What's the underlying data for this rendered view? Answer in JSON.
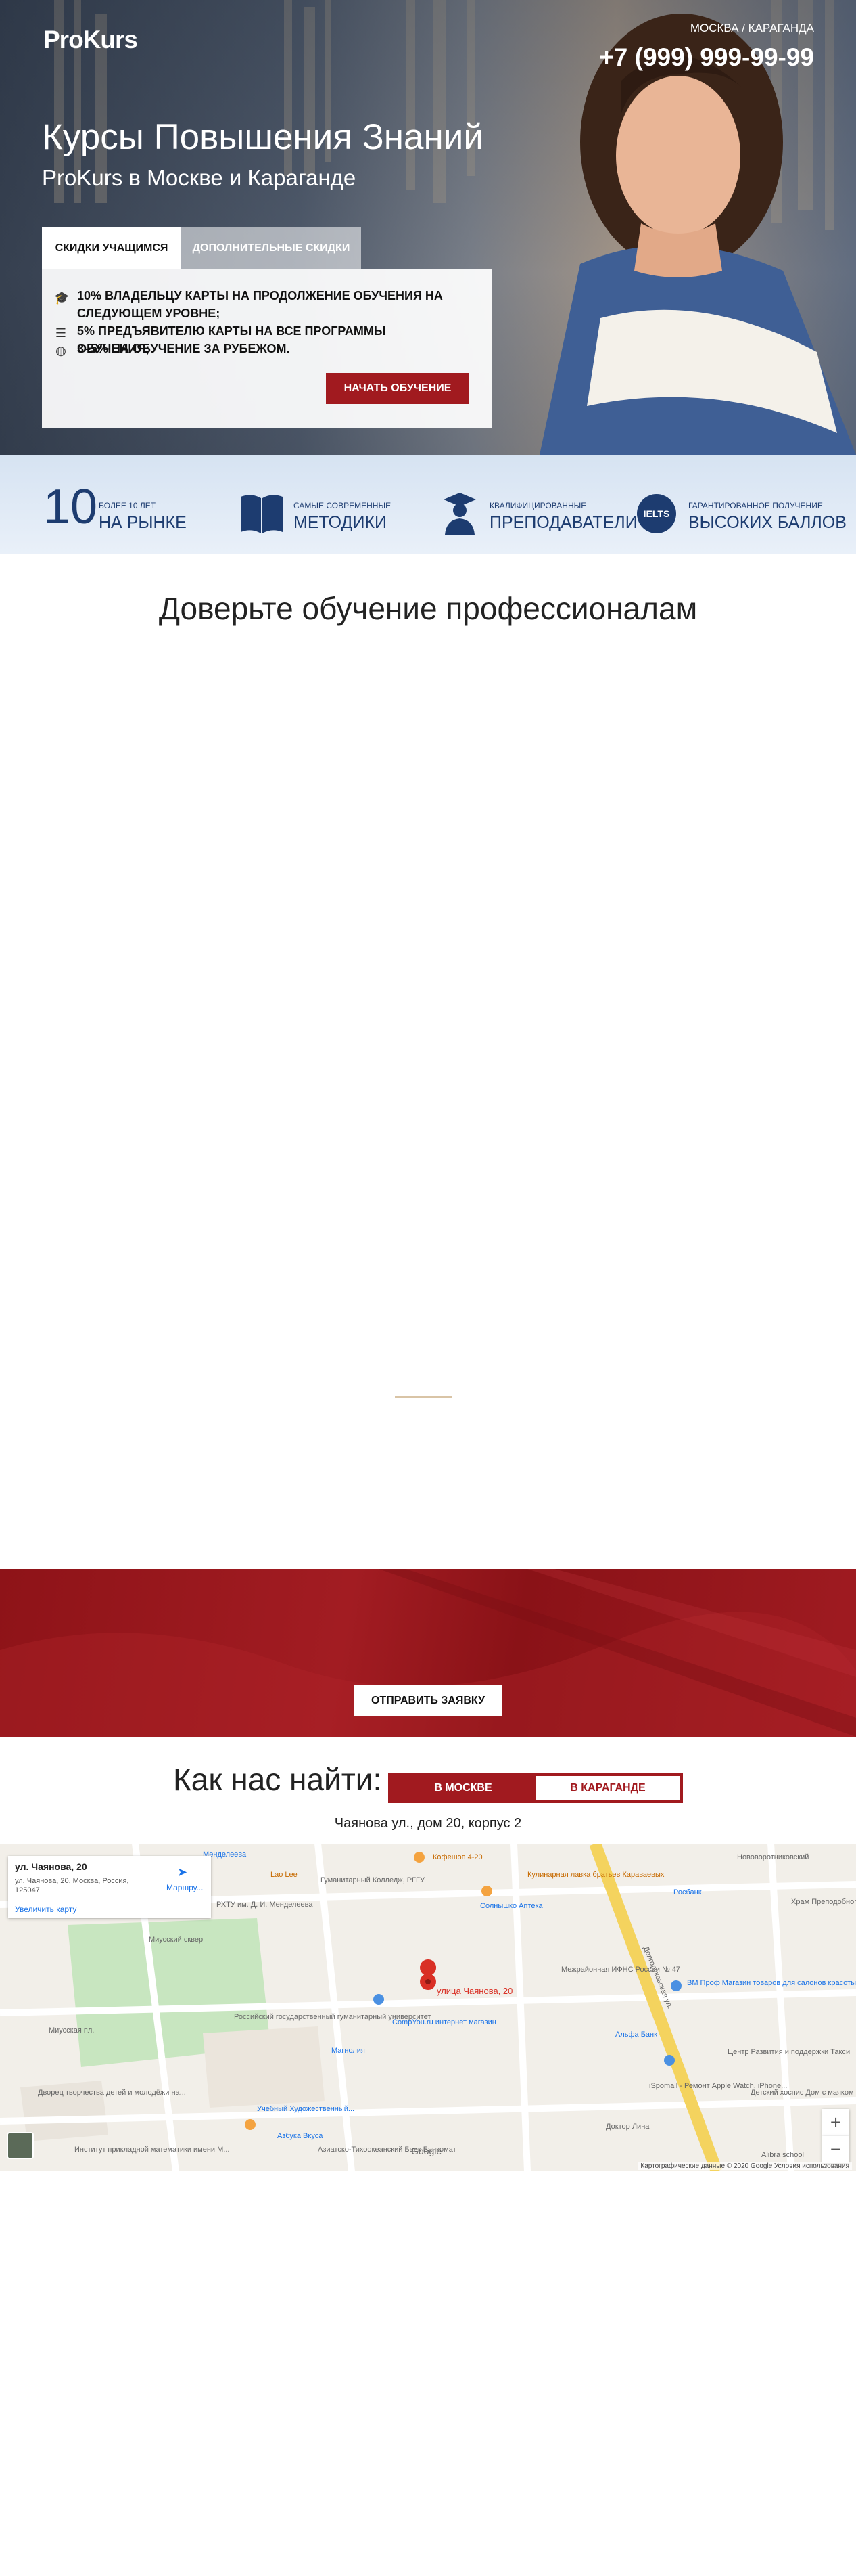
{
  "header": {
    "logo": "ProKurs",
    "cities": "МОСКВА / КАРАГАНДА",
    "phone": "+7 (999) 999-99-99"
  },
  "hero": {
    "title": "Курсы Повышения Знаний",
    "subtitle": "ProKurs в Москве и Караганде",
    "tabs": [
      {
        "label": "СКИДКИ УЧАЩИМСЯ",
        "active": true
      },
      {
        "label": "ДОПОЛНИТЕЛЬНЫЕ СКИДКИ",
        "active": false
      }
    ],
    "discounts": [
      {
        "icon": "graduation-cap-icon",
        "text": "10% ВЛАДЕЛЬЦУ КАРТЫ НА ПРОДОЛЖЕНИЕ ОБУЧЕНИЯ НА СЛЕДУЮЩЕМ УРОВНЕ;"
      },
      {
        "icon": "list-icon",
        "text": "5% ПРЕДЪЯВИТЕЛЮ КАРТЫ НА ВСЕ ПРОГРАММЫ ОБУЧЕНИЯ;"
      },
      {
        "icon": "globe-icon",
        "text": "3–5% НА ОБУЧЕНИЕ ЗА РУБЕЖОМ."
      }
    ],
    "cta": "НАЧАТЬ ОБУЧЕНИЕ"
  },
  "stats": [
    {
      "big_number": "10",
      "small": "БОЛЕЕ 10 ЛЕТ",
      "big": "НА РЫНКЕ"
    },
    {
      "icon": "book-icon",
      "small": "САМЫЕ СОВРЕМЕННЫЕ",
      "big": "МЕТОДИКИ"
    },
    {
      "icon": "teacher-icon",
      "small": "КВАЛИФИЦИРОВАННЫЕ",
      "big": "ПРЕПОДАВАТЕЛИ"
    },
    {
      "icon": "ielts-icon",
      "icon_text": "IELTS",
      "small": "ГАРАНТИРОВАННОЕ ПОЛУЧЕНИЕ",
      "big": "ВЫСОКИХ БАЛЛОВ"
    }
  ],
  "trust": {
    "title": "Доверьте обучение профессионалам"
  },
  "request": {
    "button": "ОТПРАВИТЬ ЗАЯВКУ"
  },
  "contacts": {
    "title": "Как нас найти:",
    "cities": [
      {
        "label": "В МОСКВЕ",
        "active": true
      },
      {
        "label": "В КАРАГАНДЕ",
        "active": false
      }
    ],
    "address": "Чаянова ул., дом 20, корпус 2"
  },
  "map": {
    "card_title": "ул. Чаянова, 20",
    "card_address": "ул. Чаянова, 20, Москва, Россия, 125047",
    "card_link": "Увеличить карту",
    "route": "Маршру...",
    "pin_label": "улица Чаянова, 20",
    "zoom_in": "+",
    "zoom_out": "−",
    "footer": "Картографические данные © 2020 Google   Условия использования",
    "google": "Google",
    "labels": [
      "Менделеева",
      "Lao Lee",
      "Кофешоп 4-20",
      "Кулинарная лавка братьев Караваевых",
      "Нововоротниковский",
      "Росбанк",
      "Храм Преподобного Пимена Великого",
      "РХТУ им. Д. И. Менделеева",
      "Гуманитарный Колледж, РГГУ",
      "Солнышко Аптека",
      "Миусский сквер",
      "Межрайонная ИФНС России № 47",
      "ВМ Проф Магазин товаров для салонов красоты",
      "Альфа Банк",
      "Российский государственный гуманитарный университет",
      "CompYou.ru интернет магазин",
      "Магнолия",
      "Центр Развития и поддержки Такси",
      "Миусская пл.",
      "iSpomail - Ремонт Apple Watch, iPhone...",
      "Детский хоспис Дом с маяком",
      "Дворец творчества детей и молодёжи на...",
      "Учебный Художественный...",
      "Азбука Вкуса",
      "Азиатско-Тихоокеанский Банк Банкомат",
      "Доктор Лина",
      "Институт прикладной математики имени М...",
      "Alibra school",
      "Долгоруковская ул."
    ]
  },
  "colors": {
    "accent_red": "#a11a1f",
    "navy": "#1d3c70",
    "stats_bg": "#dfe8f4"
  }
}
